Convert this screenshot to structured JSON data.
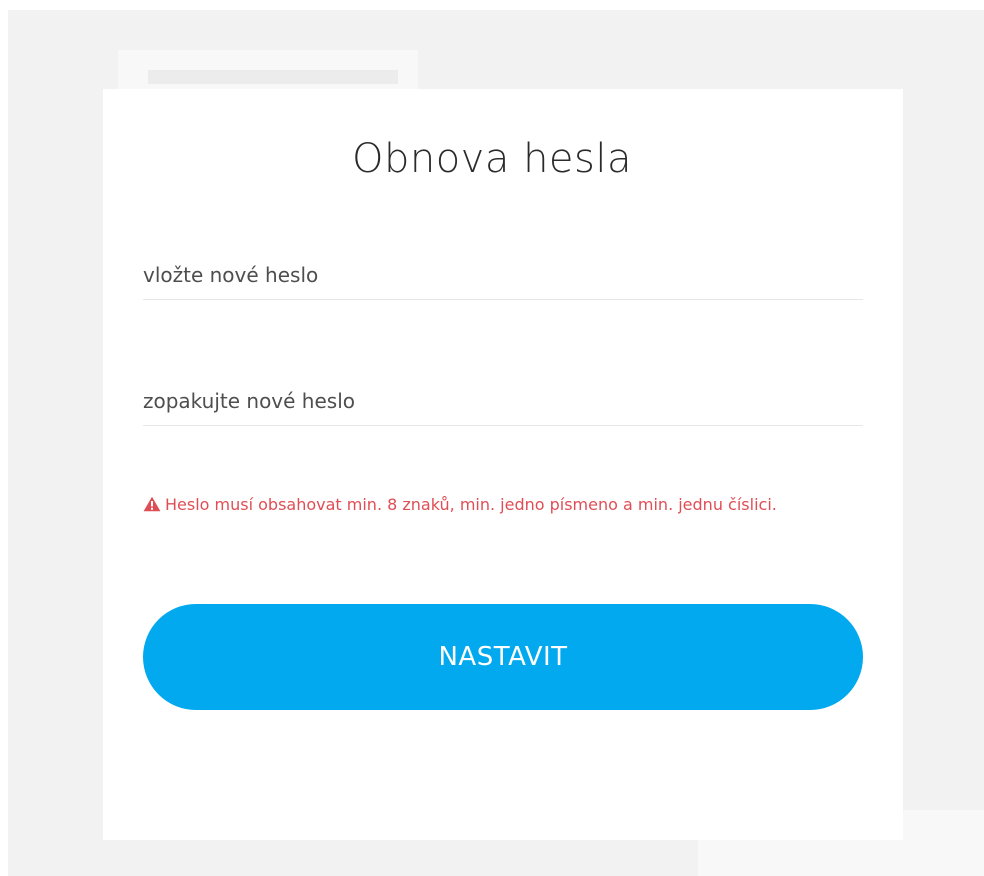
{
  "form": {
    "title": "Obnova hesla",
    "new_password": {
      "value": "",
      "placeholder": "vložte nové heslo"
    },
    "repeat_password": {
      "value": "",
      "placeholder": "zopakujte nové heslo"
    },
    "error": {
      "icon": "warning-triangle-icon",
      "text": "Heslo musí obsahovat min. 8 znaků, min. jedno písmeno a min. jednu číslici."
    },
    "submit_label": "NASTAVIT"
  },
  "colors": {
    "accent": "#03a9ef",
    "error": "#e04e55",
    "backdrop": "#f2f2f2"
  }
}
